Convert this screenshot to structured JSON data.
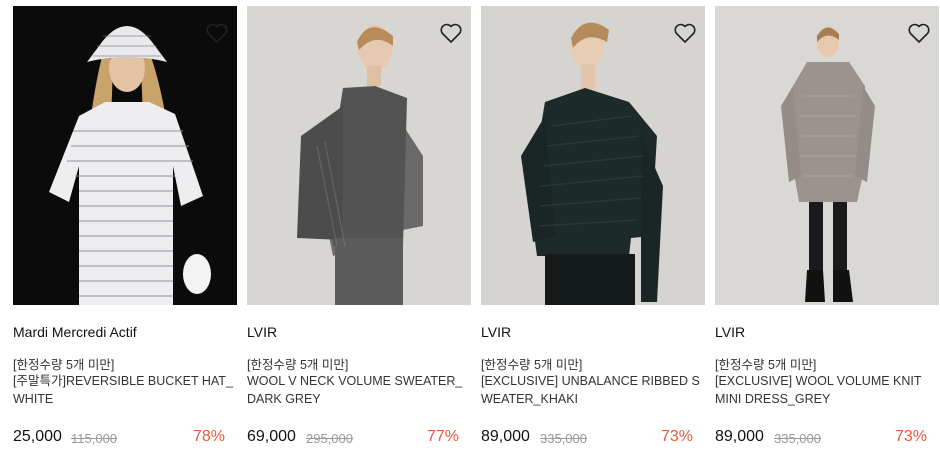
{
  "products": [
    {
      "brand": "Mardi Mercredi Actif",
      "tag": "[한정수량 5개 미만]",
      "name": "[주말특가]REVERSIBLE BUCKET HAT_WHITE",
      "price": "25,000",
      "original_price": "115,000",
      "discount": "78%",
      "image": "model-in-white-logo-print-tee-and-bucket-hat",
      "wishlist_icon": "heart-outline-icon"
    },
    {
      "brand": "LVIR",
      "tag": "[한정수량 5개 미만]",
      "name": "WOOL V NECK VOLUME SWEATER_DARK GREY",
      "price": "69,000",
      "original_price": "295,000",
      "discount": "77%",
      "image": "model-in-dark-grey-knit-vest-and-ribbed-sleeves",
      "wishlist_icon": "heart-outline-icon"
    },
    {
      "brand": "LVIR",
      "tag": "[한정수량 5개 미만]",
      "name": "[EXCLUSIVE] UNBALANCE RIBBED SWEATER_KHAKI",
      "price": "89,000",
      "original_price": "335,000",
      "discount": "73%",
      "image": "model-in-dark-green-asymmetric-sweater",
      "wishlist_icon": "heart-outline-icon"
    },
    {
      "brand": "LVIR",
      "tag": "[한정수량 5개 미만]",
      "name": "[EXCLUSIVE] WOOL VOLUME KNIT MINI DRESS_GREY",
      "price": "89,000",
      "original_price": "335,000",
      "discount": "73%",
      "image": "model-in-grey-knit-mini-dress",
      "wishlist_icon": "heart-outline-icon"
    }
  ],
  "colors": {
    "discount": "#ea5a3c",
    "original_price": "#999999",
    "text": "#222222"
  }
}
